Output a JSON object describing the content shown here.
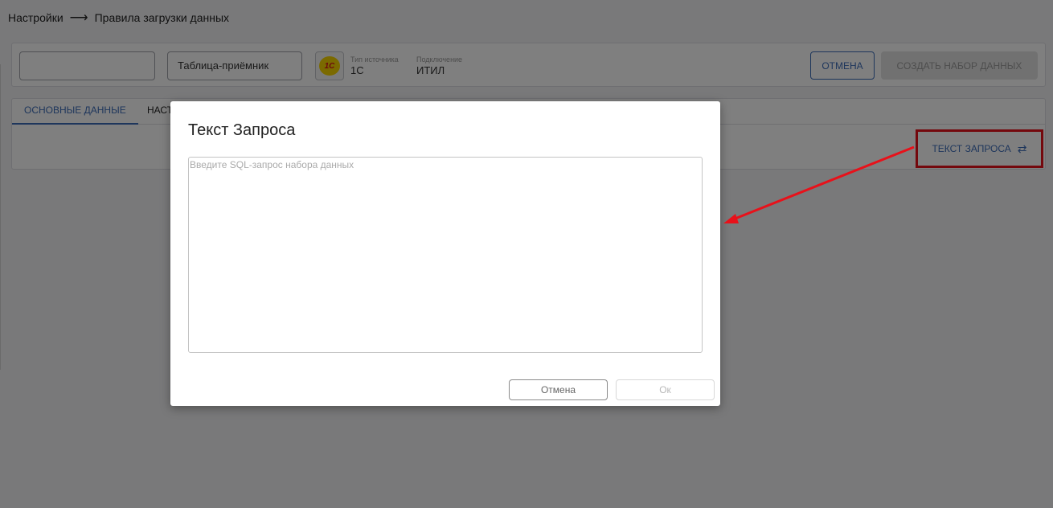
{
  "breadcrumb": {
    "root": "Настройки",
    "separator": "⟶",
    "current": "Правила загрузки данных"
  },
  "header": {
    "name_value": "",
    "target_table_value": "Таблица-приёмник",
    "source_logo_icon": "1c-logo-icon",
    "source_logo_text": "1С",
    "source_type_label": "Тип источника",
    "source_type_value": "1С",
    "connection_label": "Подключение",
    "connection_value": "ИТИЛ",
    "cancel_label": "ОТМЕНА",
    "create_label": "СОЗДАТЬ НАБОР ДАННЫХ"
  },
  "tabs": {
    "items": [
      {
        "label": "ОСНОВНЫЕ ДАННЫЕ"
      },
      {
        "label": "НАСТ"
      }
    ],
    "query_link_label": "ТЕКСТ ЗАПРОСА",
    "query_link_icon": "swap-arrows-icon"
  },
  "modal": {
    "title": "Текст Запроса",
    "textarea_value": "",
    "textarea_placeholder": "Введите SQL-запрос набора данных",
    "cancel_label": "Отмена",
    "ok_label": "Ок"
  },
  "colors": {
    "accent": "#3d6db8",
    "annotation": "#e8111a",
    "overlay": "rgba(0,0,0,0.5)"
  }
}
